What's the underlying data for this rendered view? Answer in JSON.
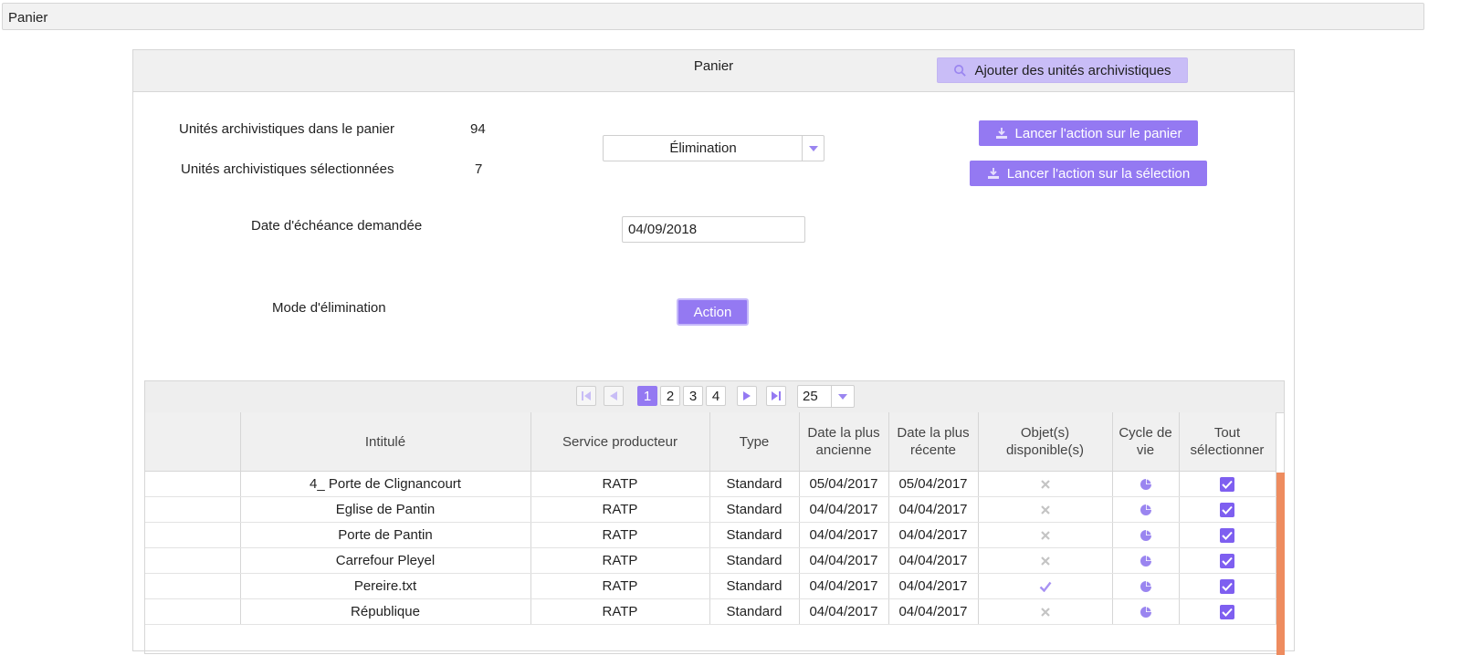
{
  "window": {
    "title": "Panier"
  },
  "panel": {
    "title": "Panier",
    "add_button_label": "Ajouter des unités archivistiques"
  },
  "stats": {
    "in_basket_label": "Unités archivistiques dans le panier",
    "in_basket_value": "94",
    "selected_label": "Unités archivistiques sélectionnées",
    "selected_value": "7"
  },
  "action_select": {
    "value": "Élimination"
  },
  "actions": {
    "basket_label": "Lancer l'action sur le panier",
    "selection_label": "Lancer l'action sur la sélection"
  },
  "due_date": {
    "label": "Date d'échéance demandée",
    "value": "04/09/2018"
  },
  "elimination_mode": {
    "label": "Mode d'élimination",
    "button_label": "Action"
  },
  "pagination": {
    "pages": [
      "1",
      "2",
      "3",
      "4"
    ],
    "current": "1",
    "page_size": "25"
  },
  "table": {
    "headers": {
      "title": "Intitulé",
      "producer": "Service producteur",
      "type": "Type",
      "oldest": "Date la plus ancienne",
      "newest": "Date la plus récente",
      "objects": "Objet(s) disponible(s)",
      "lifecycle": "Cycle de vie",
      "select_all": "Tout sélectionner"
    },
    "rows": [
      {
        "title": "4_ Porte de Clignancourt",
        "producer": "RATP",
        "type": "Standard",
        "oldest": "05/04/2017",
        "newest": "05/04/2017",
        "object_icon": "cross-icon",
        "selected": true
      },
      {
        "title": "Eglise de Pantin",
        "producer": "RATP",
        "type": "Standard",
        "oldest": "04/04/2017",
        "newest": "04/04/2017",
        "object_icon": "cross-icon",
        "selected": true
      },
      {
        "title": "Porte de Pantin",
        "producer": "RATP",
        "type": "Standard",
        "oldest": "04/04/2017",
        "newest": "04/04/2017",
        "object_icon": "cross-icon",
        "selected": true
      },
      {
        "title": "Carrefour Pleyel",
        "producer": "RATP",
        "type": "Standard",
        "oldest": "04/04/2017",
        "newest": "04/04/2017",
        "object_icon": "cross-icon",
        "selected": true
      },
      {
        "title": "Pereire.txt",
        "producer": "RATP",
        "type": "Standard",
        "oldest": "04/04/2017",
        "newest": "04/04/2017",
        "object_icon": "check-icon",
        "selected": true
      },
      {
        "title": "République",
        "producer": "RATP",
        "type": "Standard",
        "oldest": "04/04/2017",
        "newest": "04/04/2017",
        "object_icon": "cross-icon",
        "selected": true
      }
    ]
  },
  "colors": {
    "accent": "#9479f2",
    "accent_light": "#c9bdf7",
    "scrollbar": "#ee8c5f"
  }
}
